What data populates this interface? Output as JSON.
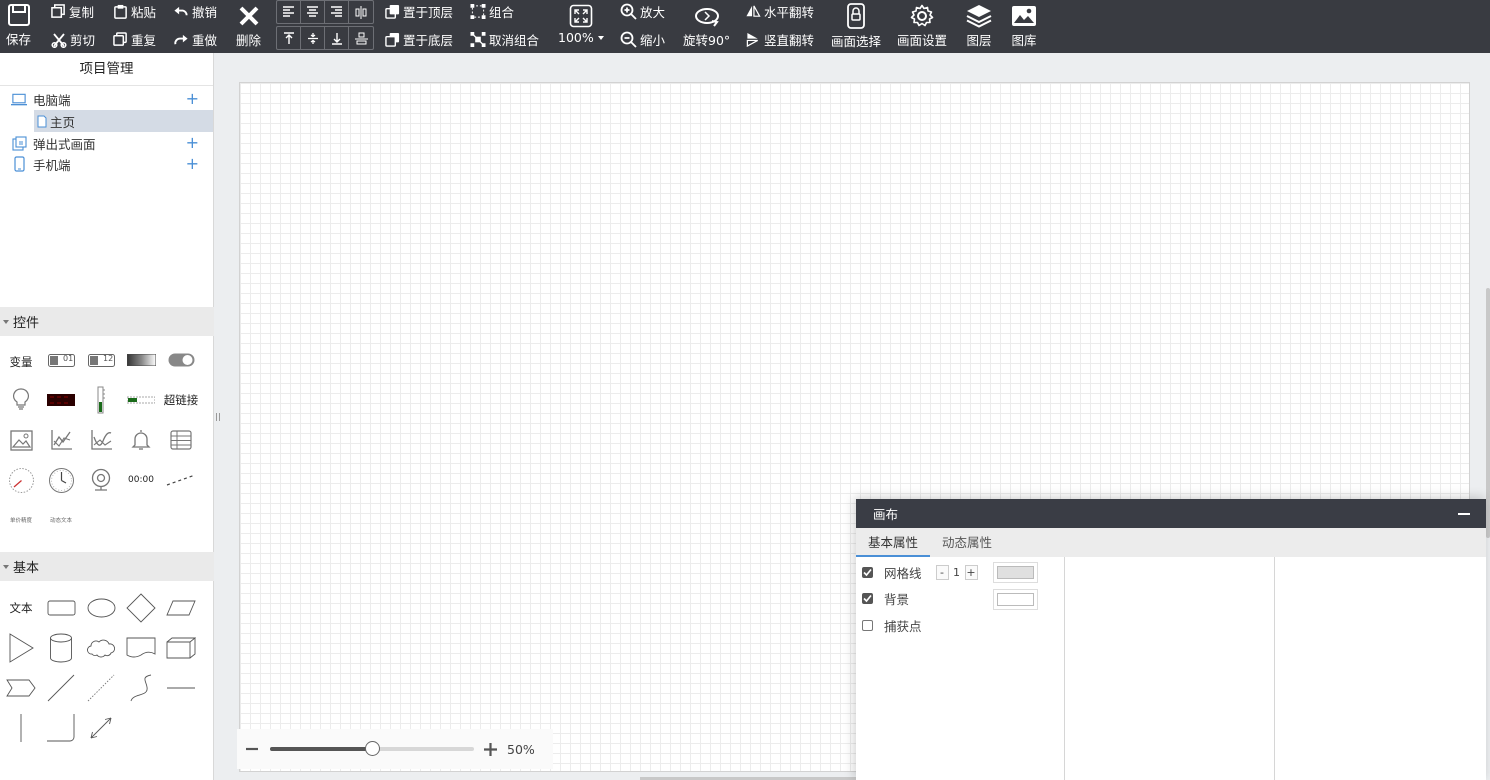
{
  "toolbar": {
    "save": "保存",
    "copy": "复制",
    "paste": "粘贴",
    "undo": "撤销",
    "cut": "剪切",
    "duplicate": "重复",
    "redo": "重做",
    "delete": "删除",
    "bring_to_top": "置于顶层",
    "send_to_bottom": "置于底层",
    "group": "组合",
    "ungroup": "取消组合",
    "zoom_level": "100%",
    "zoom_in": "放大",
    "zoom_out": "缩小",
    "rotate": "旋转90°",
    "flip_horizontal": "水平翻转",
    "flip_vertical": "竖直翻转",
    "screen_select": "画面选择",
    "screen_settings": "画面设置",
    "layers": "图层",
    "gallery": "图库"
  },
  "project": {
    "title": "项目管理",
    "items": [
      {
        "label": "电脑端",
        "icon": "desktop-icon"
      },
      {
        "label": "主页",
        "icon": "page-icon"
      },
      {
        "label": "弹出式画面",
        "icon": "popup-icon"
      },
      {
        "label": "手机端",
        "icon": "mobile-icon"
      }
    ]
  },
  "controls": {
    "title": "控件",
    "variable": "变量",
    "hyperlink": "超链接",
    "clock_text": "00:00",
    "tiny_label_1": "单价精度",
    "tiny_label_2": "动态文本",
    "badge_1": "01",
    "badge_2": "12"
  },
  "basic": {
    "title": "基本",
    "text": "文本"
  },
  "zoom": {
    "percent": "50%",
    "slider_value": 0.5
  },
  "props": {
    "title": "画布",
    "tab_basic": "基本属性",
    "tab_dynamic": "动态属性",
    "grid_label": "网格线",
    "grid_checked": true,
    "grid_value": "1",
    "grid_color": "#e0e0e0",
    "bg_label": "背景",
    "bg_checked": true,
    "bg_color": "#ffffff",
    "snap_label": "捕获点",
    "snap_checked": false,
    "step_minus": "-",
    "step_plus": "+"
  },
  "colors": {
    "toolbar_bg": "#393b41",
    "accent": "#4a8fd6",
    "selected_row": "#d4dbe5"
  }
}
